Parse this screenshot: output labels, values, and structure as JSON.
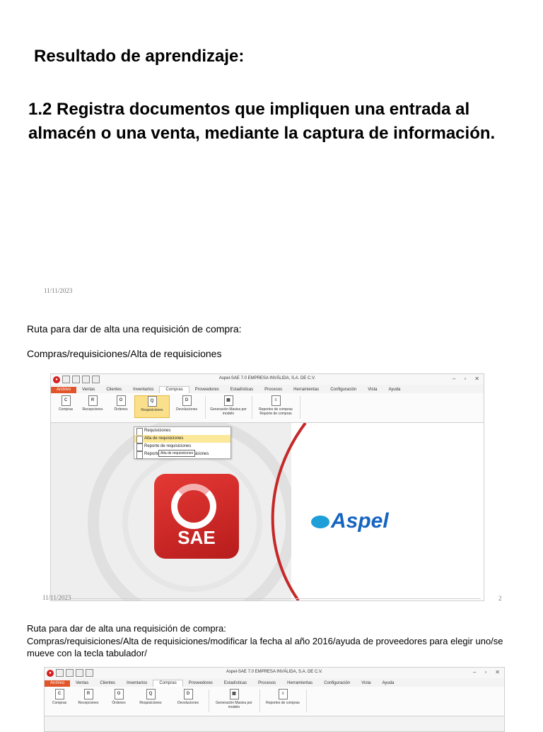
{
  "slide1": {
    "heading": "Resultado de aprendizaje:",
    "subheading": "1.2 Registra documentos que impliquen una entrada al almacén o una venta, mediante la captura de información.",
    "date": "11/11/2023"
  },
  "slide2": {
    "line1": "Ruta para dar de alta una requisición de compra:",
    "line2": "Compras/requisiciones/Alta de requisiciones",
    "date": "11/11/2023",
    "page_number": "2"
  },
  "slide3": {
    "line1": "Ruta para dar de alta una requisición de compra:",
    "line2": "Compras/requisiciones/Alta de requisiciones/modificar la fecha al año 2016/ayuda de proveedores para elegir uno/se mueve con la tecla tabulador/"
  },
  "app": {
    "window_title": "Aspel-SAE 7.0  EMPRESA INVÁLIDA, S.A. DE C.V.",
    "menu": [
      "Archivo",
      "Ventas",
      "Clientes",
      "Inventarios",
      "Compras",
      "Proveedores",
      "Estadísticas",
      "Procesos",
      "Herramientas",
      "Configuración",
      "Vista",
      "Ayuda"
    ],
    "ribbon": [
      "Compras",
      "Recepciones",
      "Órdenes",
      "Requisiciones",
      "Devoluciones",
      "Generación Masiva por modelo",
      "Reportes de compras"
    ],
    "ribbon_group_label": "Reporte de compras",
    "dropdown": [
      "Requisiciones",
      "Alta de requisiciones",
      "Reporte de requisiciones",
      "Reporte resumen de requisiciones"
    ],
    "tooltip": "Alta de requisiciones",
    "logo_text": "SAE",
    "brand": "Aspel"
  }
}
